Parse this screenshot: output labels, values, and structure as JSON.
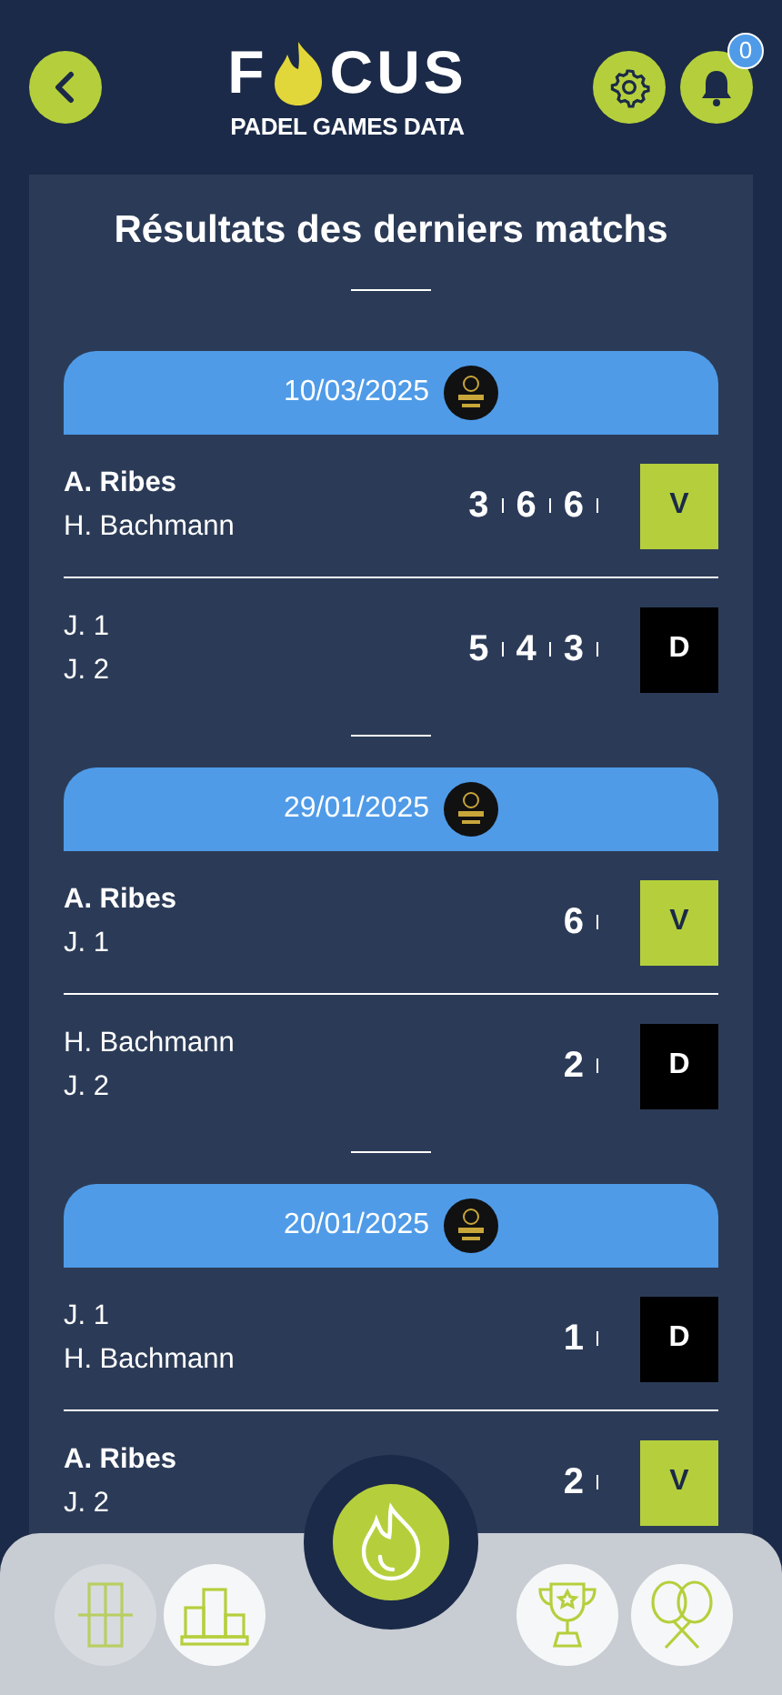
{
  "header": {
    "logo": {
      "start": "F",
      "end": "CUS",
      "subtitle": "PADEL GAMES DATA"
    },
    "notifications": {
      "count": "0"
    }
  },
  "title": "Résultats des derniers matchs",
  "matches": [
    {
      "date": "10/03/2025",
      "rows": [
        {
          "players": [
            {
              "name": "A. Ribes",
              "highlight": true
            },
            {
              "name": "H. Bachmann",
              "highlight": false
            }
          ],
          "scores": [
            "3",
            "6",
            "6"
          ],
          "result": {
            "label": "V",
            "kind": "win"
          }
        },
        {
          "players": [
            {
              "name": "J. 1",
              "highlight": false
            },
            {
              "name": "J. 2",
              "highlight": false
            }
          ],
          "scores": [
            "5",
            "4",
            "3"
          ],
          "result": {
            "label": "D",
            "kind": "loss"
          }
        }
      ]
    },
    {
      "date": "29/01/2025",
      "rows": [
        {
          "players": [
            {
              "name": "A. Ribes",
              "highlight": true
            },
            {
              "name": "J. 1",
              "highlight": false
            }
          ],
          "scores": [
            "6"
          ],
          "result": {
            "label": "V",
            "kind": "win"
          }
        },
        {
          "players": [
            {
              "name": "H. Bachmann",
              "highlight": false
            },
            {
              "name": "J. 2",
              "highlight": false
            }
          ],
          "scores": [
            "2"
          ],
          "result": {
            "label": "D",
            "kind": "loss"
          }
        }
      ]
    },
    {
      "date": "20/01/2025",
      "rows": [
        {
          "players": [
            {
              "name": "J. 1",
              "highlight": false
            },
            {
              "name": "H. Bachmann",
              "highlight": false
            }
          ],
          "scores": [
            "1"
          ],
          "result": {
            "label": "D",
            "kind": "loss"
          }
        },
        {
          "players": [
            {
              "name": "A. Ribes",
              "highlight": true
            },
            {
              "name": "J. 2",
              "highlight": false
            }
          ],
          "scores": [
            "2"
          ],
          "result": {
            "label": "V",
            "kind": "win"
          }
        }
      ]
    }
  ],
  "bottom_nav": [
    {
      "kind": "court",
      "selected": true
    },
    {
      "kind": "podium",
      "selected": false
    },
    {
      "kind": "flame",
      "selected": false
    },
    {
      "kind": "trophy",
      "selected": false
    },
    {
      "kind": "rackets",
      "selected": false
    }
  ]
}
